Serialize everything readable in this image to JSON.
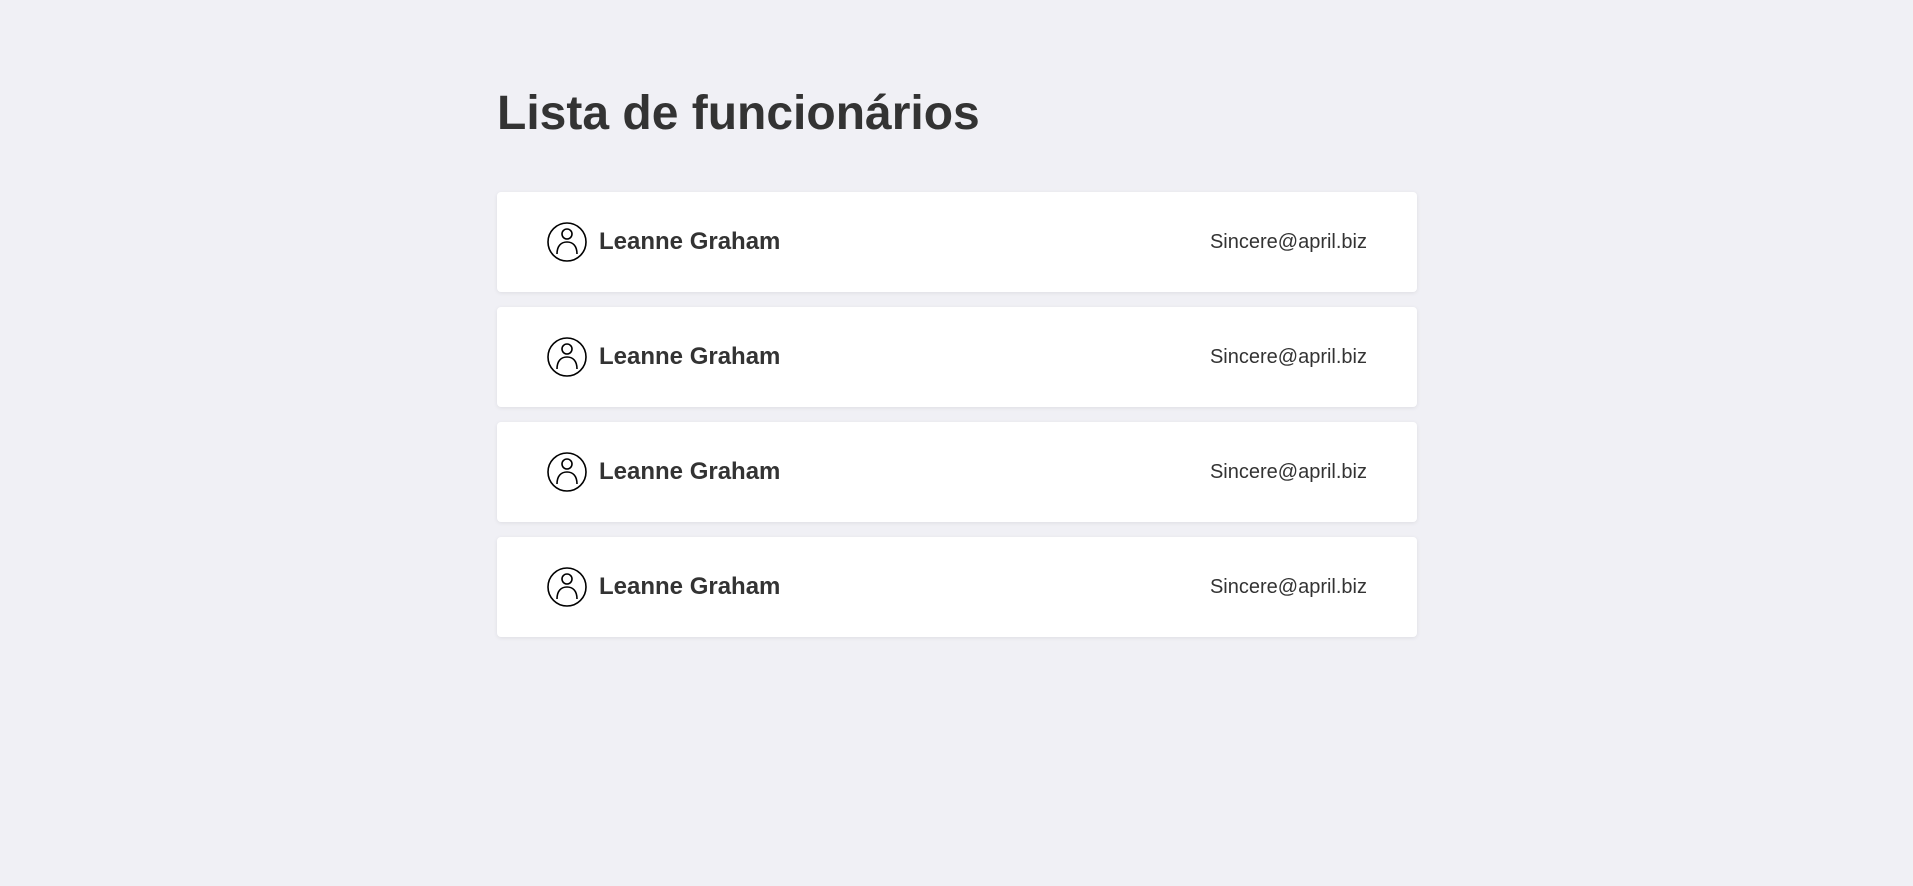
{
  "page": {
    "title": "Lista de funcionários"
  },
  "employees": [
    {
      "name": "Leanne Graham",
      "email": "Sincere@april.biz",
      "icon": "user-circle-icon"
    },
    {
      "name": "Leanne Graham",
      "email": "Sincere@april.biz",
      "icon": "user-circle-icon"
    },
    {
      "name": "Leanne Graham",
      "email": "Sincere@april.biz",
      "icon": "user-circle-icon"
    },
    {
      "name": "Leanne Graham",
      "email": "Sincere@april.biz",
      "icon": "user-circle-icon"
    }
  ],
  "colors": {
    "background": "#f0f0f5",
    "card": "#ffffff",
    "text": "#333333"
  }
}
